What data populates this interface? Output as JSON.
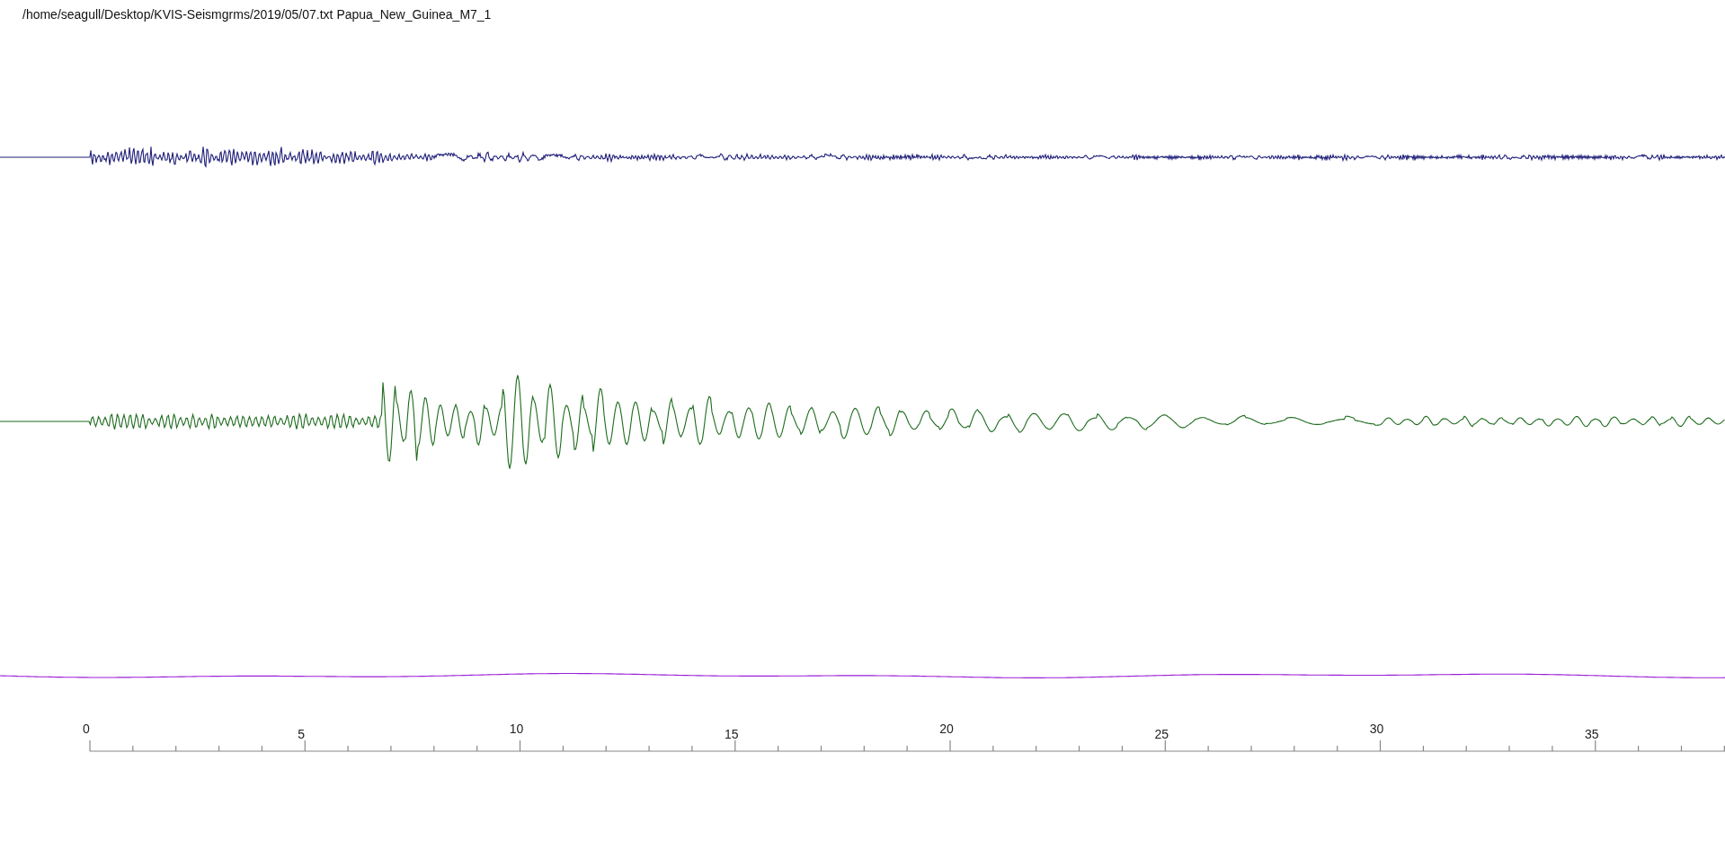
{
  "title": "/home/seagull/Desktop/KVIS-Seismgrms/2019/05/07.txt Papua_New_Guinea_M7_1",
  "traces": [
    {
      "kind": "short-period",
      "color": "#1f1f7a"
    },
    {
      "kind": "long-period",
      "color": "#1d6b1d"
    },
    {
      "kind": "flat",
      "color": "#9b1fd6"
    }
  ],
  "axis": {
    "labels": [
      "0",
      "5",
      "10",
      "15",
      "20",
      "25",
      "30",
      "35"
    ]
  }
}
